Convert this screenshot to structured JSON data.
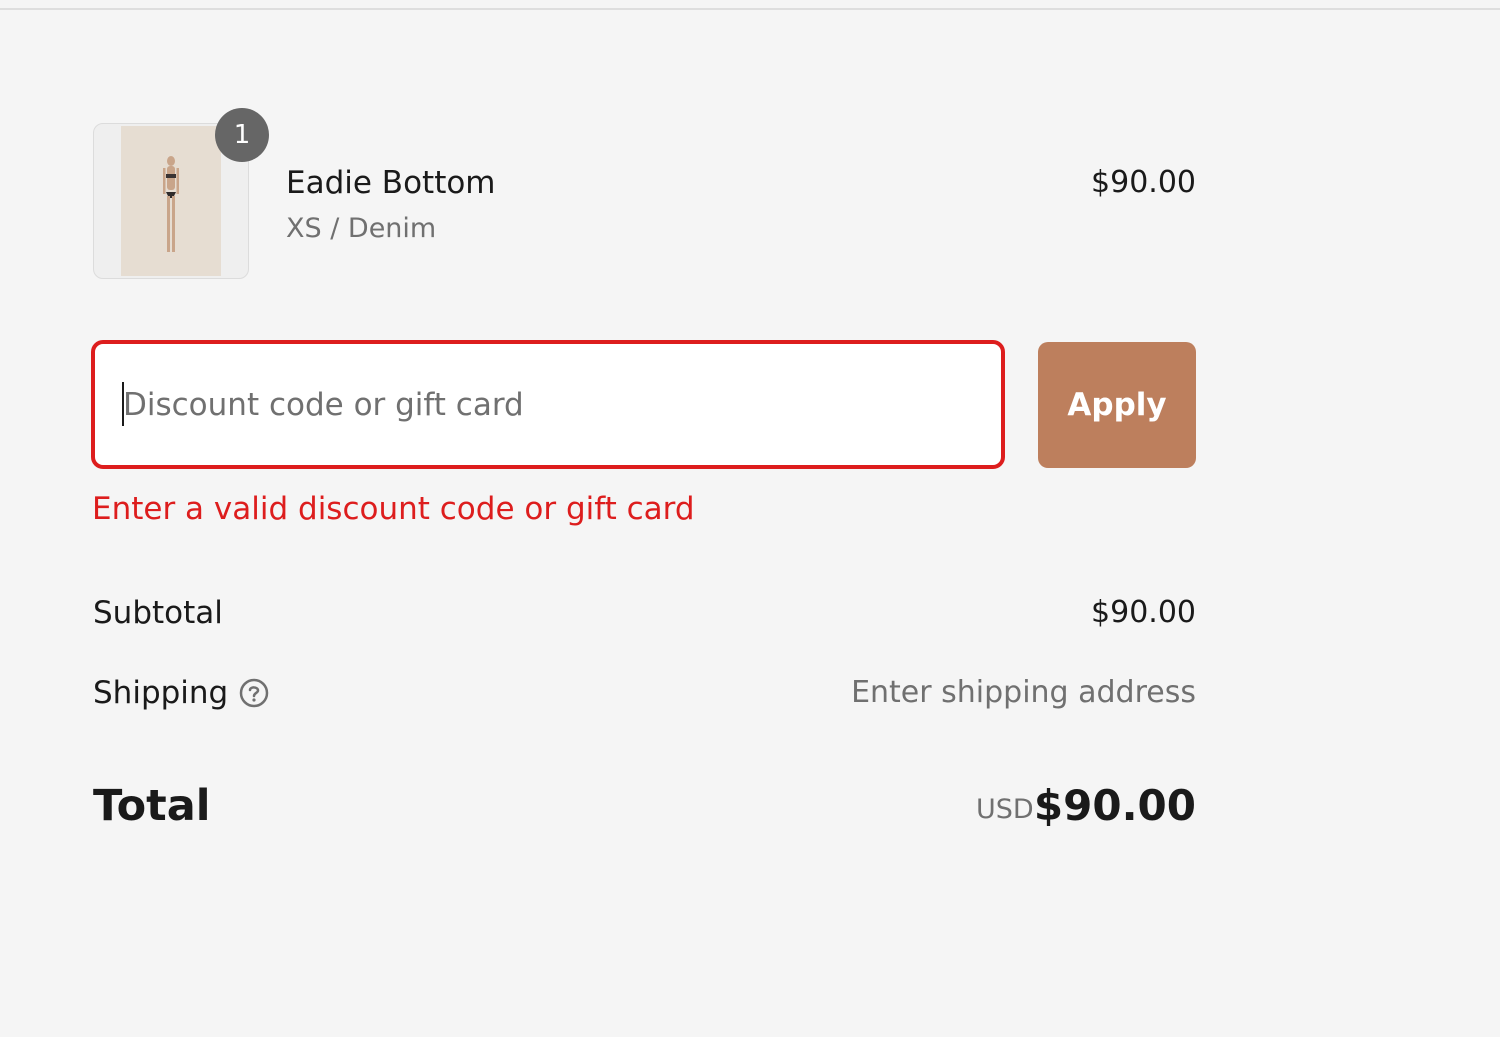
{
  "line_item": {
    "quantity": "1",
    "name": "Eadie Bottom",
    "variant": "XS / Denim",
    "price": "$90.00"
  },
  "discount": {
    "placeholder": "Discount code or gift card",
    "value": "",
    "apply_label": "Apply",
    "error": "Enter a valid discount code or gift card"
  },
  "summary": {
    "subtotal_label": "Subtotal",
    "subtotal_value": "$90.00",
    "shipping_label": "Shipping",
    "shipping_value": "Enter shipping address",
    "total_label": "Total",
    "total_currency": "USD",
    "total_value": "$90.00"
  },
  "colors": {
    "accent": "#bd7f5d",
    "error": "#dd1d1d",
    "background": "#f5f5f5",
    "muted_text": "#707070"
  }
}
